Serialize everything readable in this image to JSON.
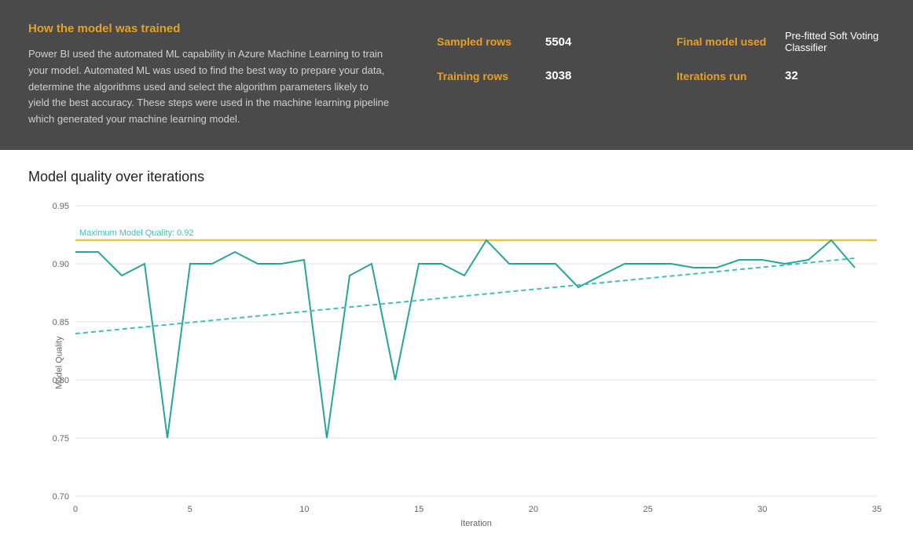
{
  "header": {
    "title": "How the model was trained",
    "description": "Power BI used the automated ML capability in Azure Machine Learning to train your model. Automated ML was used to find the best way to prepare your data, determine the algorithms used and select the algorithm parameters likely to yield the best accuracy. These steps were used in the machine learning pipeline which generated your machine learning model.",
    "stats": [
      {
        "label": "Sampled rows",
        "value": "5504"
      },
      {
        "label": "Final model used",
        "value": "Pre-fitted Soft Voting Classifier"
      },
      {
        "label": "Training rows",
        "value": "3038"
      },
      {
        "label": "Iterations run",
        "value": "32"
      }
    ]
  },
  "chart": {
    "title": "Model quality over iterations",
    "yAxisLabel": "Model Quality",
    "xAxisLabel": "Iteration",
    "maxQualityLabel": "Maximum Model Quality: 0.92",
    "maxQualityValue": 0.92,
    "yMin": 0.7,
    "yMax": 0.95,
    "xMin": 0,
    "xMax": 35
  }
}
